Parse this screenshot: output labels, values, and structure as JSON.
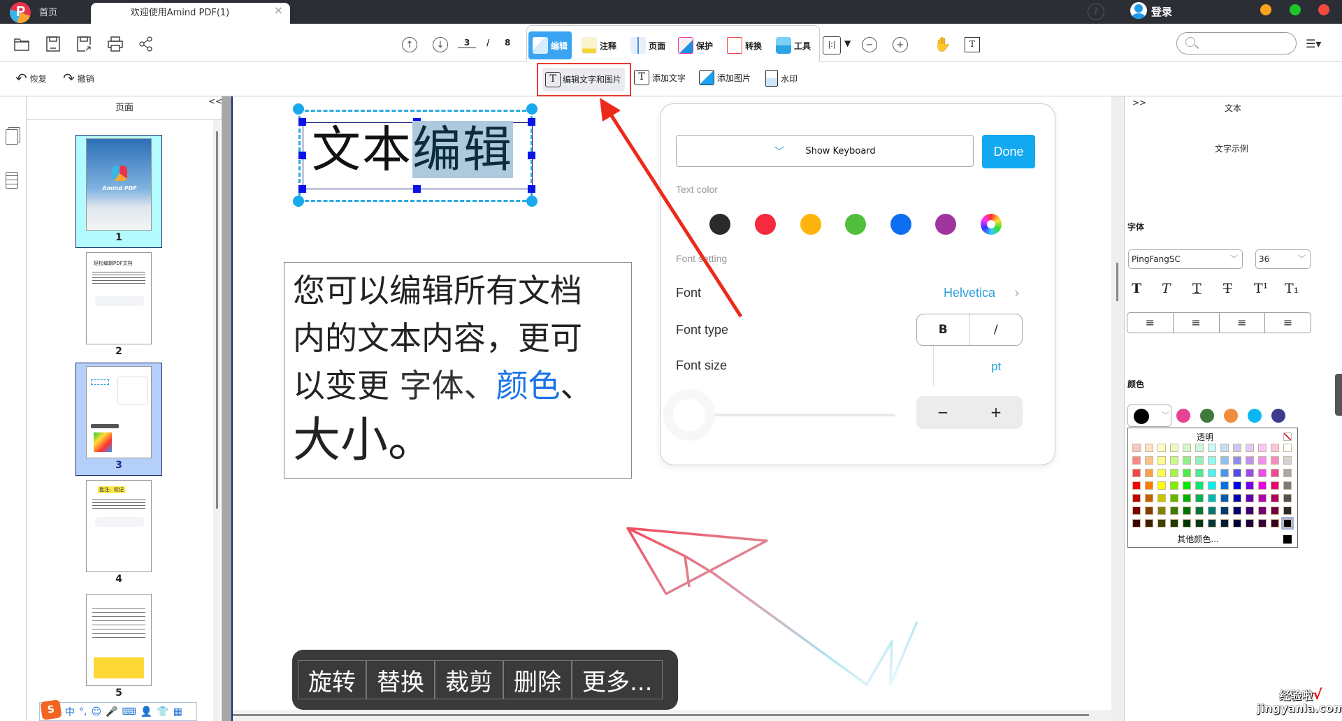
{
  "titlebar": {
    "home_tab": "首页",
    "doc_tab": "欢迎使用Amind PDF(1)",
    "close": "×",
    "help": "?",
    "login": "登录",
    "window_dots": [
      "#f9a21a",
      "#1ec62c",
      "#f24a3e"
    ]
  },
  "toolbar": {
    "page_current": "3",
    "page_sep": "/",
    "page_total": "8",
    "tabs": [
      {
        "label": "编辑",
        "icon": "edit-icon",
        "active": true
      },
      {
        "label": "注释",
        "icon": "annotate-icon"
      },
      {
        "label": "页面",
        "icon": "page-icon"
      },
      {
        "label": "保护",
        "icon": "protect-icon"
      },
      {
        "label": "转换",
        "icon": "convert-icon"
      },
      {
        "label": "工具",
        "icon": "tools-icon"
      }
    ],
    "layout_label": "|:|",
    "dropdown": "▼",
    "zoom_out": "−",
    "zoom_in": "+",
    "view_menu": "☰▾"
  },
  "subtoolbar": {
    "undo": "恢复",
    "redo": "撤销",
    "edit_text_image": "编辑文字和图片",
    "add_text": "添加文字",
    "add_image": "添加图片",
    "watermark": "水印"
  },
  "thumbnails": {
    "title": "页面",
    "collapse": "<<",
    "pages": [
      {
        "num": "1",
        "state": "cyan"
      },
      {
        "num": "2",
        "state": "none"
      },
      {
        "num": "3",
        "state": "selected"
      },
      {
        "num": "4",
        "state": "none"
      },
      {
        "num": "5",
        "state": "none"
      }
    ],
    "page1_caption": "Amind PDF",
    "page2_heading": "轻松编辑PDF文档",
    "page4_heading": "批注、标记"
  },
  "document": {
    "title_plain": "文本",
    "title_selected": "编辑",
    "body_line1": "您可以编辑所有文档",
    "body_line2": "内的文本内容，更可",
    "body_line3a": "以变更 ",
    "body_line3b": "字体、",
    "body_line3c": "颜色",
    "body_line3d": "、",
    "body_line4": "大小。"
  },
  "popup": {
    "show_keyboard": "Show Keyboard",
    "done": "Done",
    "text_color_label": "Text color",
    "text_colors": [
      "#2a2a2a",
      "#f5293f",
      "#fdb40c",
      "#51be3d",
      "#0d6ef0",
      "#a1359f"
    ],
    "font_setting_label": "Font setting",
    "font_label": "Font",
    "font_value": "Helvetica",
    "font_type_label": "Font type",
    "bold": "B",
    "italic": "/",
    "font_size_label": "Font size",
    "font_size_unit": "pt",
    "font_size_slider": 0,
    "minus": "−",
    "plus": "+"
  },
  "float_menu": [
    "旋转",
    "替换",
    "裁剪",
    "删除",
    "更多..."
  ],
  "right_panel": {
    "expand": ">>",
    "title": "文本",
    "sample": "文字示例",
    "font_section": "字体",
    "font_family": "PingFangSC",
    "font_size": "36",
    "format_buttons": [
      "T",
      "T",
      "T",
      "T",
      "T¹",
      "T₁"
    ],
    "align_buttons": [
      "≡",
      "≡",
      "≡",
      "≡"
    ],
    "color_section": "颜色",
    "current_color": "#000000",
    "quick_colors": [
      "#e84393",
      "#3e7a3c",
      "#f08c3a",
      "#0bb7f2",
      "#3c3c8e"
    ],
    "palette_title": "透明",
    "palette_more": "其他颜色...",
    "palette_rows": [
      [
        "#fbc5c5",
        "#fde2c4",
        "#fefec5",
        "#e8fcc5",
        "#cdf9cd",
        "#c8f7df",
        "#c7fbfb",
        "#c5ddf9",
        "#c9c8f7",
        "#e2c8f7",
        "#f9c8f7",
        "#f9c8dd",
        "#ffffff"
      ],
      [
        "#f78888",
        "#fbc28c",
        "#fdfd8c",
        "#c8f98c",
        "#8ef18e",
        "#8ff0c2",
        "#8ff7f7",
        "#8ebff3",
        "#8e8ef0",
        "#c08ef0",
        "#f18ef0",
        "#f28ebf",
        "#d3d3d3"
      ],
      [
        "#f24848",
        "#f9a04c",
        "#fdfd4c",
        "#a4f54c",
        "#4ced4c",
        "#4ce89a",
        "#4cf3f3",
        "#4c97ee",
        "#4c4cec",
        "#9a4ceb",
        "#ec4cec",
        "#ee4c97",
        "#a8a8a8"
      ],
      [
        "#f30000",
        "#fb7d00",
        "#fefe00",
        "#7df000",
        "#00e800",
        "#00e873",
        "#00f1f1",
        "#0073e8",
        "#0000e8",
        "#7300e8",
        "#e800e8",
        "#e80073",
        "#7c7c7c"
      ],
      [
        "#b80000",
        "#c06000",
        "#c6c600",
        "#60b800",
        "#00b000",
        "#00b05a",
        "#00b8b8",
        "#005ab0",
        "#0000b0",
        "#5a00b0",
        "#b000b0",
        "#b0005a",
        "#525252"
      ],
      [
        "#780000",
        "#7e3f00",
        "#828200",
        "#3f7a00",
        "#007300",
        "#00733a",
        "#007878",
        "#003a73",
        "#000073",
        "#3a0073",
        "#730073",
        "#73003a",
        "#2a2a2a"
      ],
      [
        "#3a0000",
        "#3c1f00",
        "#3f3f00",
        "#1f3b00",
        "#003800",
        "#00381c",
        "#003a3a",
        "#001c38",
        "#000038",
        "#1c0038",
        "#380038",
        "#38001c",
        "#000000"
      ]
    ]
  },
  "ime_bar": {
    "logo": "S",
    "items": [
      "中",
      "°,",
      "☺",
      "🎤",
      "⌨",
      "👤",
      "👕",
      "▦"
    ]
  },
  "watermark": {
    "line1": "经验啦",
    "check": "√",
    "line2": "jingyanla.com"
  }
}
